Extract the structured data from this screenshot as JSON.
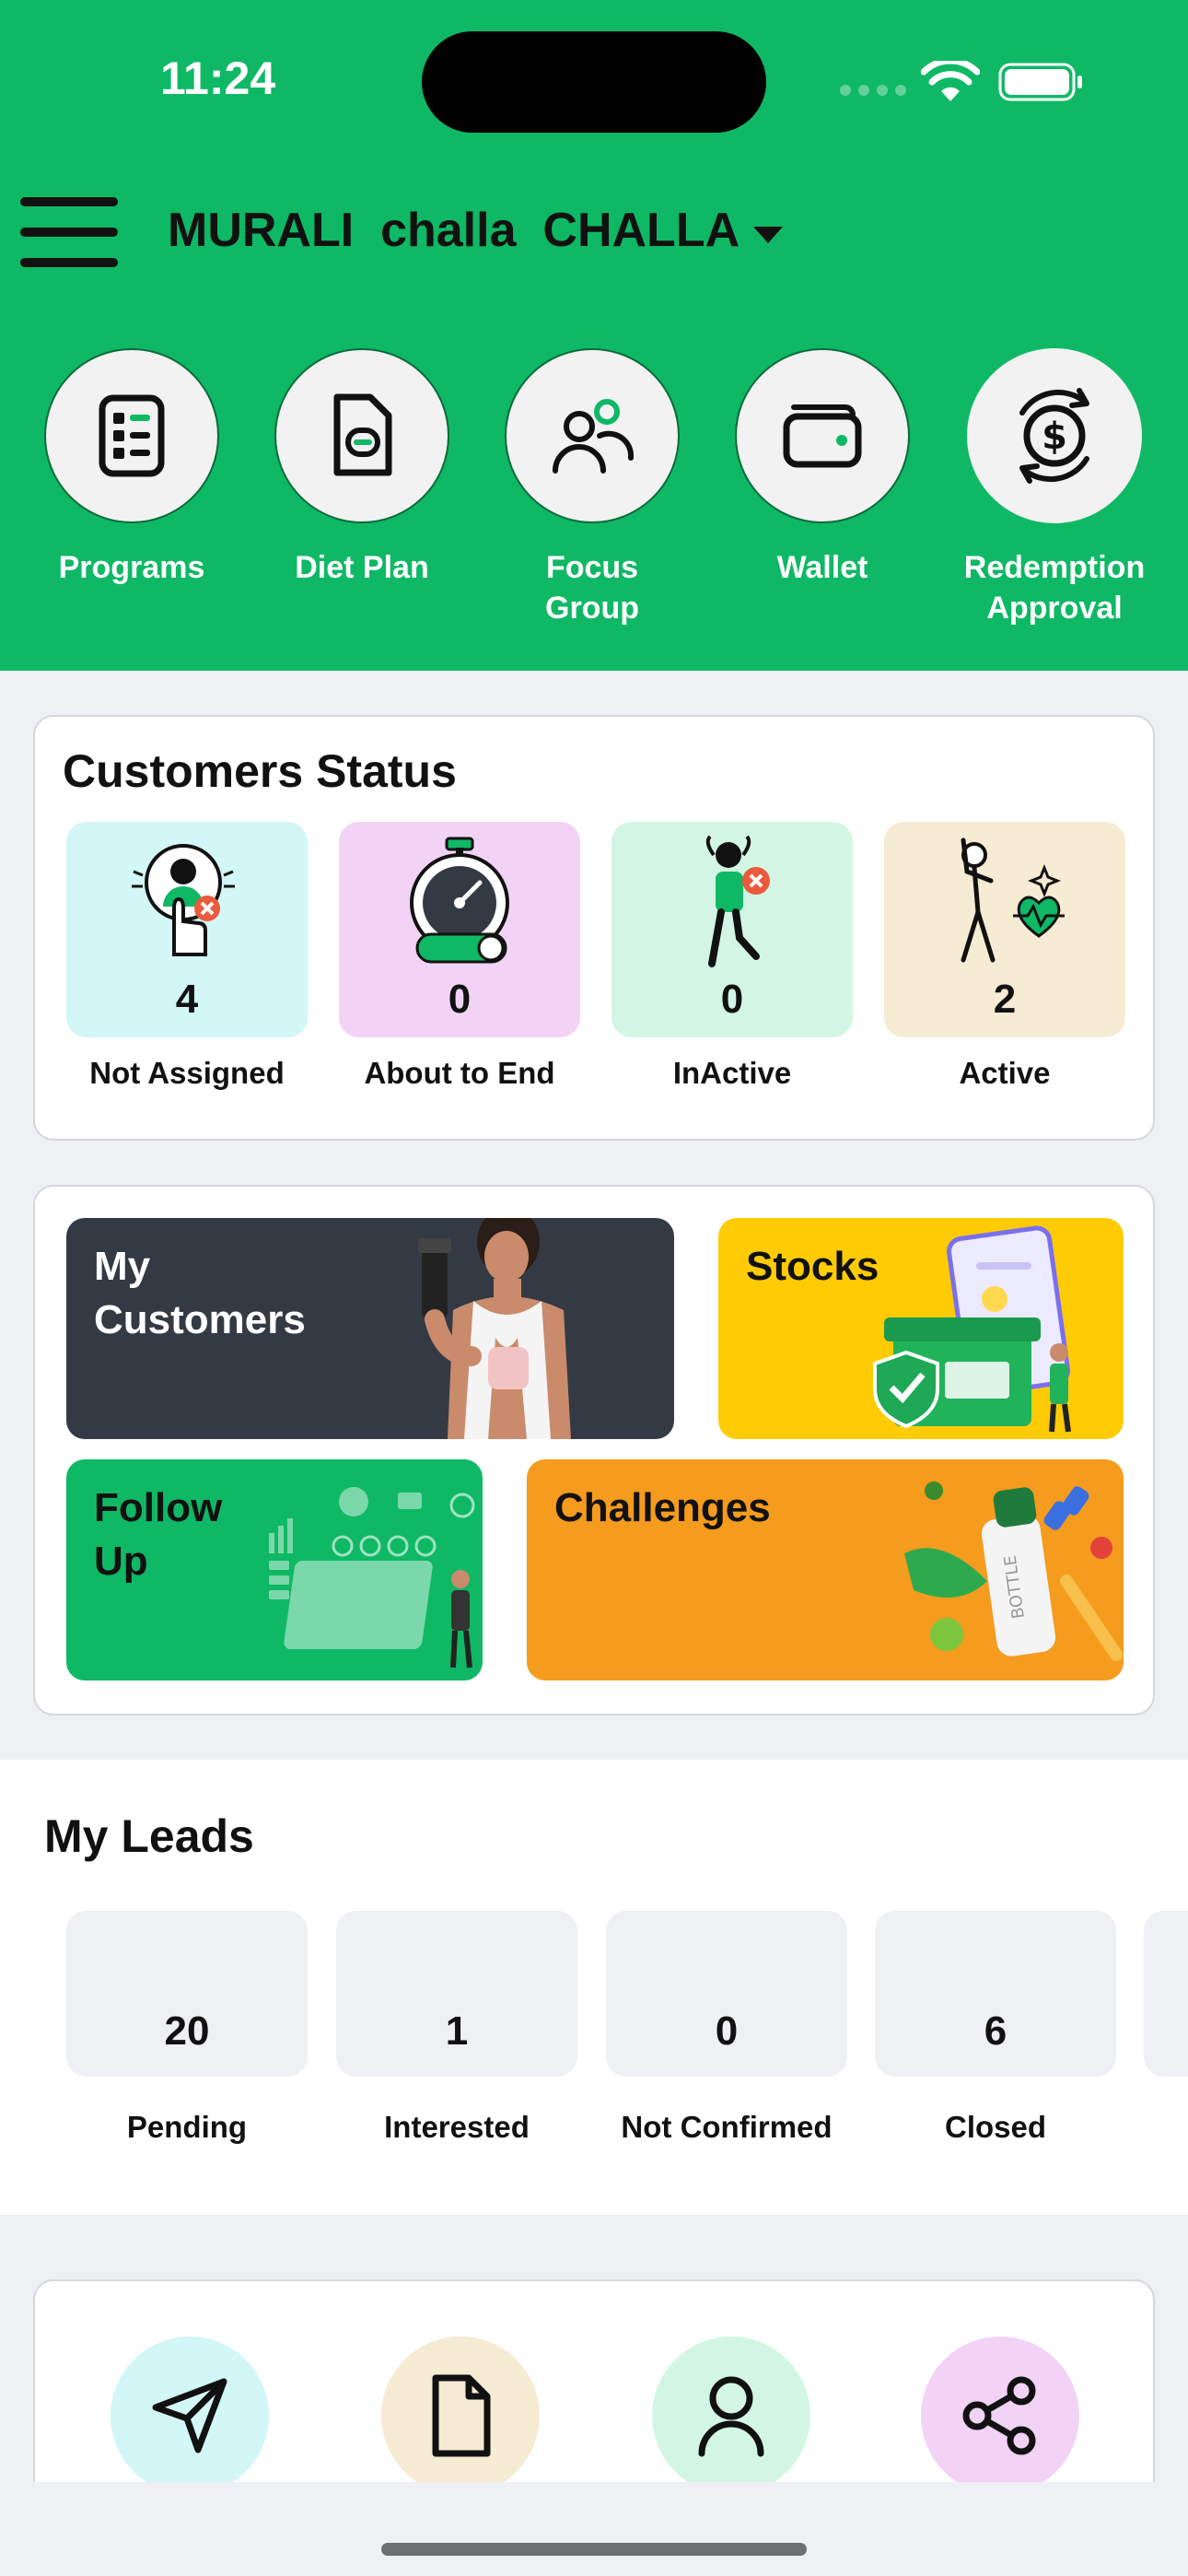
{
  "status_bar": {
    "time": "11:24"
  },
  "header": {
    "user_name": "MURALI  challa  CHALLA",
    "shortcuts": [
      {
        "label": "Programs",
        "icon": "program-list-icon"
      },
      {
        "label": "Diet Plan",
        "icon": "document-icon"
      },
      {
        "label": "Focus\nGroup",
        "icon": "group-icon"
      },
      {
        "label": "Wallet",
        "icon": "wallet-icon"
      },
      {
        "label": "Redemption\nApproval",
        "icon": "dollar-cycle-icon"
      }
    ]
  },
  "customers_status": {
    "title": "Customers Status",
    "tiles": [
      {
        "value": "4",
        "label": "Not Assigned",
        "color": "#d3f6f6"
      },
      {
        "value": "0",
        "label": "About to End",
        "color": "#f2d3f6"
      },
      {
        "value": "0",
        "label": "InActive",
        "color": "#d3f6e4"
      },
      {
        "value": "2",
        "label": "Active",
        "color": "#f6ebd3"
      }
    ]
  },
  "features": {
    "my_customers": "My\nCustomers",
    "stocks": "Stocks",
    "follow_up": "Follow\nUp",
    "challenges": "Challenges",
    "colors": {
      "my_customers": "#343a44",
      "stocks": "#ffcb05",
      "follow_up": "#0fb865",
      "challenges": "#f59b1e"
    }
  },
  "leads": {
    "title": "My Leads",
    "items": [
      {
        "value": "20",
        "label": "Pending"
      },
      {
        "value": "1",
        "label": "Interested"
      },
      {
        "value": "0",
        "label": "Not Confirmed"
      },
      {
        "value": "6",
        "label": "Closed"
      }
    ]
  },
  "actions": [
    {
      "icon": "send-icon",
      "color": "#d3f6f6"
    },
    {
      "icon": "file-icon",
      "color": "#f6ebd3"
    },
    {
      "icon": "person-icon",
      "color": "#d3f6e4"
    },
    {
      "icon": "share-icon",
      "color": "#f2d3f6"
    }
  ],
  "brand_green": "#0fb865"
}
